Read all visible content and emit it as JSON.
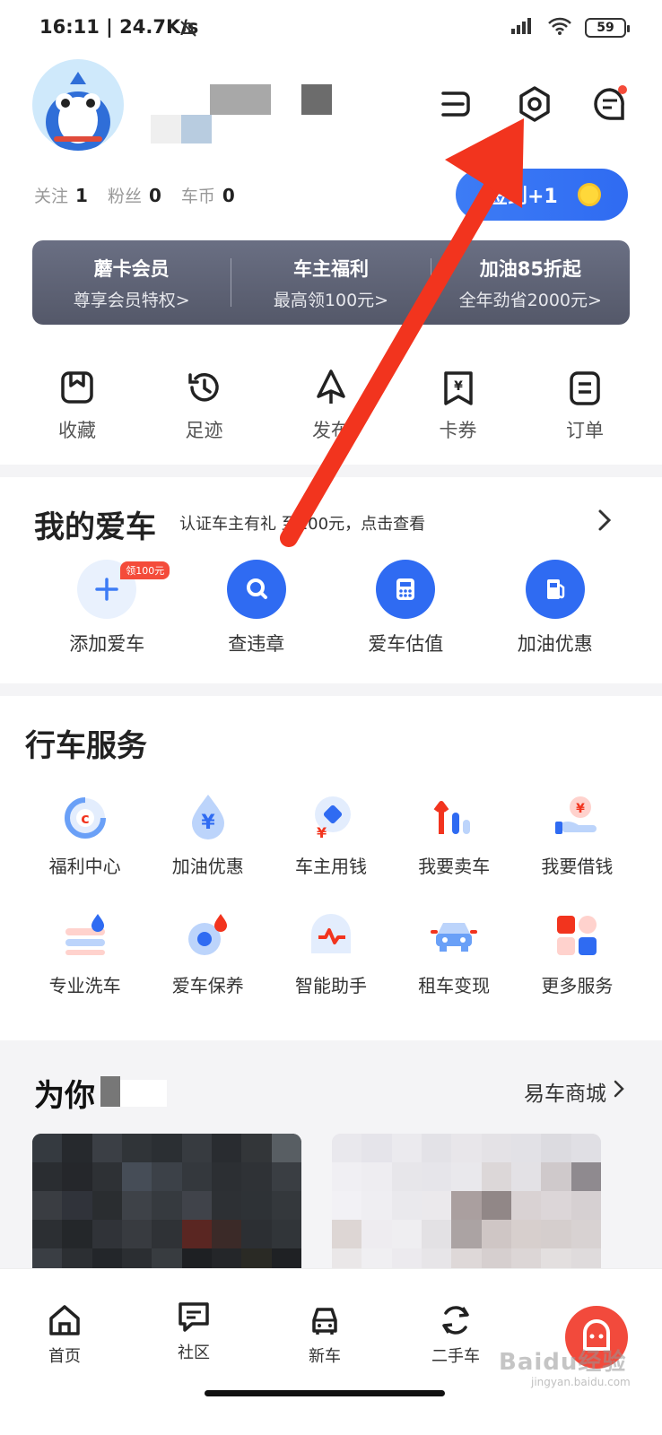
{
  "status_bar": {
    "time": "16:11 | 24.7K/s",
    "battery": "59"
  },
  "profile": {
    "stats": [
      {
        "label": "关注",
        "value": "1"
      },
      {
        "label": "粉丝",
        "value": "0"
      },
      {
        "label": "车币",
        "value": "0"
      }
    ],
    "signin_label": "签到+1"
  },
  "member_banner": [
    {
      "title": "蘑卡会员",
      "sub": "尊享会员特权>"
    },
    {
      "title": "车主福利",
      "sub": "最高领100元>"
    },
    {
      "title": "加油85折起",
      "sub": "全年劲省2000元>"
    }
  ],
  "quick_menu": [
    {
      "label": "收藏",
      "icon": "bookmark-icon"
    },
    {
      "label": "足迹",
      "icon": "history-icon"
    },
    {
      "label": "发布",
      "icon": "publish-icon"
    },
    {
      "label": "卡券",
      "icon": "coupon-icon"
    },
    {
      "label": "订单",
      "icon": "order-icon"
    }
  ],
  "my_car": {
    "title": "我的爱车",
    "promo": "认证车主有礼 至100元，点击查看",
    "badge": "领100元",
    "items": [
      {
        "label": "添加爱车",
        "icon": "plus-icon"
      },
      {
        "label": "查违章",
        "icon": "search-icon"
      },
      {
        "label": "爱车估值",
        "icon": "calculator-icon"
      },
      {
        "label": "加油优惠",
        "icon": "fuel-icon"
      }
    ]
  },
  "services": {
    "title": "行车服务",
    "items": [
      {
        "label": "福利中心",
        "icon": "welfare-icon"
      },
      {
        "label": "加油优惠",
        "icon": "fuel-drop-icon"
      },
      {
        "label": "车主用钱",
        "icon": "money-icon"
      },
      {
        "label": "我要卖车",
        "icon": "sell-car-icon"
      },
      {
        "label": "我要借钱",
        "icon": "borrow-icon"
      },
      {
        "label": "专业洗车",
        "icon": "car-wash-icon"
      },
      {
        "label": "爱车保养",
        "icon": "maintenance-icon"
      },
      {
        "label": "智能助手",
        "icon": "assistant-icon"
      },
      {
        "label": "租车变现",
        "icon": "rent-car-icon"
      },
      {
        "label": "更多服务",
        "icon": "more-services-icon"
      }
    ]
  },
  "recommend": {
    "title": "为你",
    "mall_link": "易车商城"
  },
  "tab_bar": [
    {
      "label": "首页",
      "icon": "home-icon"
    },
    {
      "label": "社区",
      "icon": "community-icon"
    },
    {
      "label": "新车",
      "icon": "new-car-icon"
    },
    {
      "label": "二手车",
      "icon": "used-car-icon"
    }
  ],
  "watermark": {
    "text": "Baidu经验",
    "sub": "jingyan.baidu.com"
  },
  "colors": {
    "accent": "#3d7cf5",
    "arrow": "#f2341e",
    "badge": "#f44b3a"
  }
}
